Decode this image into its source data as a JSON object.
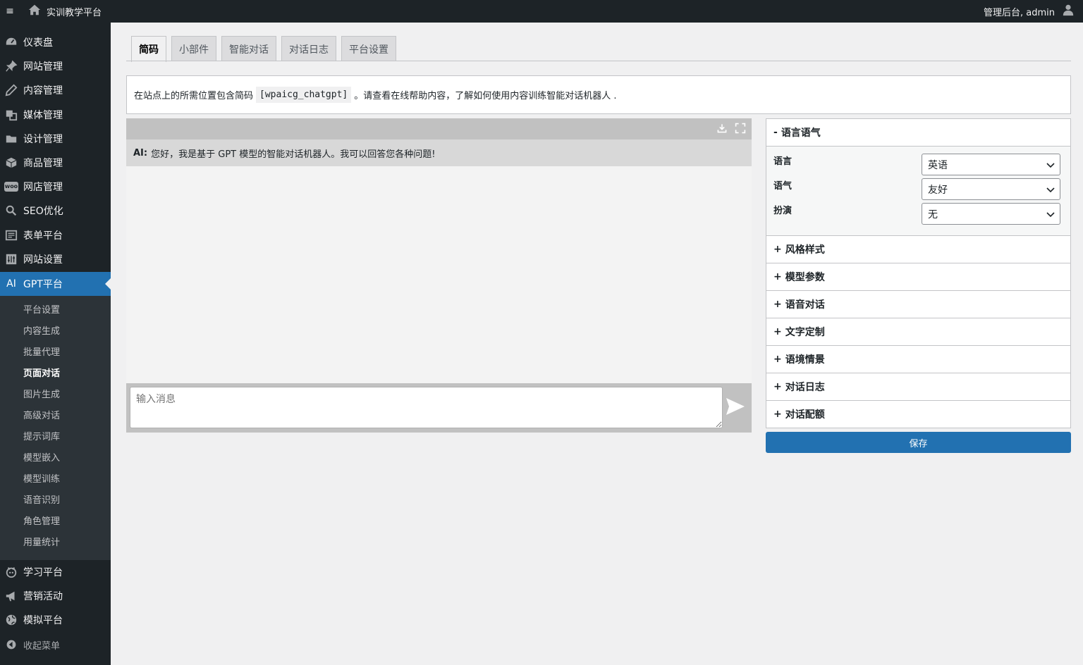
{
  "topbar": {
    "menu_glyph": "≡",
    "site_name": "实训教学平台",
    "account": "管理后台, admin"
  },
  "sidebar": {
    "items": [
      {
        "label": "仪表盘",
        "icon": "dashboard-icon"
      },
      {
        "label": "网站管理",
        "icon": "pin-icon"
      },
      {
        "label": "内容管理",
        "icon": "pencil-icon"
      },
      {
        "label": "媒体管理",
        "icon": "media-icon"
      },
      {
        "label": "设计管理",
        "icon": "folder-icon"
      },
      {
        "label": "商品管理",
        "icon": "box-icon"
      },
      {
        "label": "网店管理",
        "icon": "woo-icon"
      },
      {
        "label": "SEO优化",
        "icon": "search-icon"
      },
      {
        "label": "表单平台",
        "icon": "form-icon"
      },
      {
        "label": "网站设置",
        "icon": "settings-icon"
      },
      {
        "label": "GPT平台",
        "icon": "ai-icon",
        "active": true
      }
    ],
    "ai_icon_text": "AI",
    "woo_icon_text": "woo",
    "submenu": [
      "平台设置",
      "内容生成",
      "批量代理",
      "页面对话",
      "图片生成",
      "高级对话",
      "提示词库",
      "模型嵌入",
      "模型训练",
      "语音识别",
      "角色管理",
      "用量统计"
    ],
    "submenu_current": "页面对话",
    "bottom_items": [
      {
        "label": "学习平台",
        "icon": "learning-icon"
      },
      {
        "label": "营销活动",
        "icon": "megaphone-icon"
      },
      {
        "label": "模拟平台",
        "icon": "globe-icon"
      }
    ],
    "collapse": "收起菜单"
  },
  "tabs": [
    "简码",
    "小部件",
    "智能对话",
    "对话日志",
    "平台设置"
  ],
  "active_tab": "简码",
  "notice": {
    "before": "在站点上的所需位置包含简码",
    "shortcode": "[wpaicg_chatgpt]",
    "after": "。请查看在线帮助内容，了解如何使用内容训练智能对话机器人 ."
  },
  "chat": {
    "ai_label": "AI:",
    "ai_message": "您好，我是基于 GPT 模型的智能对话机器人。我可以回答您各种问题!",
    "input_placeholder": "输入消息"
  },
  "settings": {
    "open_section": {
      "sign": "-",
      "title": "语言语气",
      "fields": [
        {
          "label": "语言",
          "value": "英语"
        },
        {
          "label": "语气",
          "value": "友好"
        },
        {
          "label": "扮演",
          "value": "无"
        }
      ]
    },
    "sections": [
      "风格样式",
      "模型参数",
      "语音对话",
      "文字定制",
      "语境情景",
      "对话日志",
      "对话配额"
    ],
    "closed_sign": "+",
    "save_label": "保存"
  },
  "colors": {
    "sidebar_bg": "#1d2327",
    "accent": "#2271b1",
    "chat_header": "#c1c1c1"
  }
}
